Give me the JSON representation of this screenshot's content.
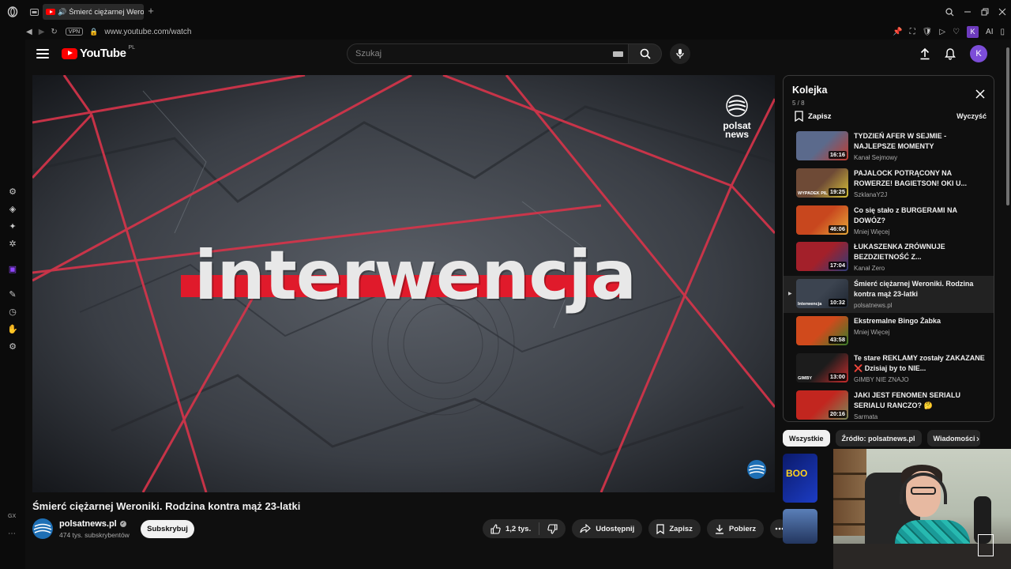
{
  "browser": {
    "tab_title": "Śmierć ciężarnej Weroniki",
    "url": "www.youtube.com/watch",
    "vpn_label": "VPN",
    "ext_avatar": "K",
    "ext_ai_label": "AI",
    "gx_label": "GX"
  },
  "header": {
    "logo_text": "YouTube",
    "country_code": "PL",
    "search_placeholder": "Szukaj",
    "avatar_letter": "K"
  },
  "video": {
    "title": "Śmierć ciężarnej Weroniki. Rodzina kontra mąż 23-latki",
    "show_title": "interwencja",
    "channel_logo": "polsat news",
    "channel": {
      "name": "polsatnews.pl",
      "subscribers": "474 tys. subskrybentów",
      "subscribe_label": "Subskrybuj"
    },
    "actions": {
      "likes": "1,2 tys.",
      "share": "Udostępnij",
      "save": "Zapisz",
      "download": "Pobierz"
    }
  },
  "queue": {
    "title": "Kolejka",
    "position": "5 / 8",
    "save_label": "Zapisz",
    "clear_label": "Wyczyść",
    "items": [
      {
        "title": "TYDZIEŃ AFER W SEJMIE - NAJLEPSZE MOMENTY",
        "channel": "Kanał Sejmowy",
        "duration": "16:16",
        "color1": "#5b6a8c",
        "color2": "#c23a2e",
        "label": ""
      },
      {
        "title": "PAJALOCK POTRĄCONY NA ROWERZE! BAGIETSON! OKI U...",
        "channel": "SzklanaY2J",
        "duration": "19:25",
        "color1": "#6e4a36",
        "color2": "#d8c33a",
        "label": "WYPADEK PIL"
      },
      {
        "title": "Co się stało z BURGERAMI NA DOWÓZ?",
        "channel": "Mniej Więcej",
        "duration": "46:06",
        "color1": "#c8471e",
        "color2": "#e8a93a",
        "label": ""
      },
      {
        "title": "ŁUKASZENKA ZRÓWNUJE BEZDZIETNOŚĆ Z...",
        "channel": "Kanał Zero",
        "duration": "17:04",
        "color1": "#a3202a",
        "color2": "#2d3c7a",
        "label": ""
      },
      {
        "title": "Śmierć ciężarnej Weroniki. Rodzina kontra mąż 23-latki",
        "channel": "polsatnews.pl",
        "duration": "10:32",
        "color1": "#3c4450",
        "color2": "#1e2530",
        "label": "Interwencja",
        "active": true
      },
      {
        "title": "Ekstremalne Bingo Żabka",
        "channel": "Mniej Więcej",
        "duration": "43:58",
        "color1": "#d04a1c",
        "color2": "#3a7d2a",
        "label": ""
      },
      {
        "title": "Te stare REKLAMY zostały ZAKAZANE ❌ Dzisiaj by to NIE...",
        "channel": "GIMBY NIE ZNAJO",
        "duration": "13:00",
        "color1": "#1c1c1c",
        "color2": "#c92d2d",
        "label": "GIMBY"
      },
      {
        "title": "JAKI JEST FENOMEN SERIALU SERIALU RANCZO? 🤔",
        "channel": "Sarmata",
        "duration": "20:16",
        "color1": "#c2261f",
        "color2": "#7a8a5a",
        "label": ""
      }
    ]
  },
  "chips": [
    "Wszystkie",
    "Źródło: polsatnews.pl",
    "Wiadomości"
  ],
  "recommendation": {
    "thumb1_text": "BOO"
  }
}
